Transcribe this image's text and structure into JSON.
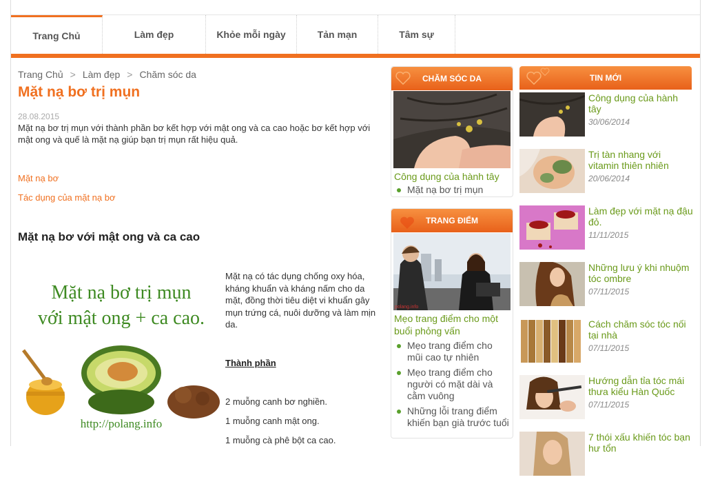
{
  "nav": {
    "items": [
      "Trang Chủ",
      "Làm đẹp",
      "Khỏe mỗi ngày",
      "Tản mạn",
      "Tâm sự"
    ]
  },
  "breadcrumb": [
    "Trang Chủ",
    "Làm đẹp",
    "Chăm sóc da"
  ],
  "article": {
    "title": "Mặt nạ bơ trị mụn",
    "date": "28.08.2015",
    "intro": "Mặt nạ bơ trị mụn với thành phần bơ kết hợp với mật ong và ca cao hoặc bơ kết hợp với mật ong và quế là mặt nạ giúp bạn trị mụn rất hiệu quả.",
    "links": [
      "Mặt nạ bơ",
      "Tác dụng của mặt nạ bơ"
    ],
    "subheading": "Mặt nạ bơ với mật ong và ca cao",
    "image_text": {
      "line1": "Mặt nạ bơ trị mụn",
      "line2": "với mật ong + ca cao.",
      "url": "http://polang.info"
    },
    "body": " Mặt nạ có tác dụng chống oxy hóa, kháng khuẩn và kháng nấm cho da mặt, đồng thời tiêu diệt vi khuẩn gây mụn trứng cá, nuôi dưỡng và làm mịn da.",
    "ingredients_title": "Thành phần",
    "ingredients": [
      "2 muỗng canh bơ nghiền.",
      "1 muỗng canh mật ong.",
      "1 muỗng cà phê bột ca cao."
    ]
  },
  "box_cham_soc": {
    "title": "CHĂM SÓC DA",
    "main_link": "Công dụng của hành tây",
    "items": [
      "Mặt nạ bơ trị mụn"
    ]
  },
  "box_trang_diem": {
    "title": "TRANG ĐIỂM",
    "main_link": "Mẹo trang điểm cho một buổi phỏng vấn",
    "items": [
      "Mẹo trang điểm cho mũi cao tự nhiên",
      "Mẹo trang điểm cho người có mặt dài và cằm vuông",
      "Những lỗi trang điểm khiến bạn già trước tuổi"
    ],
    "watermark": "polang.info"
  },
  "tin_moi": {
    "title": "TIN MỚI",
    "items": [
      {
        "title": "Công dụng của hành tây",
        "date": "30/06/2014"
      },
      {
        "title": "Trị tàn nhang với vitamin thiên nhiên",
        "date": "20/06/2014"
      },
      {
        "title": "Làm đẹp với mặt nạ đậu đỏ.",
        "date": "11/11/2015"
      },
      {
        "title": "Những lưu ý khi nhuộm tóc ombre",
        "date": "07/11/2015"
      },
      {
        "title": "Cách chăm sóc tóc nối tại nhà",
        "date": "07/11/2015"
      },
      {
        "title": "Hướng dẫn tỉa tóc mái thưa kiểu Hàn Quốc",
        "date": "07/11/2015"
      },
      {
        "title": "7 thói xấu khiến tóc bạn hư tổn",
        "date": ""
      }
    ]
  },
  "colors": {
    "accent": "#f07020",
    "link_green": "#6a9a1a",
    "bullet": "#5aa02c"
  }
}
